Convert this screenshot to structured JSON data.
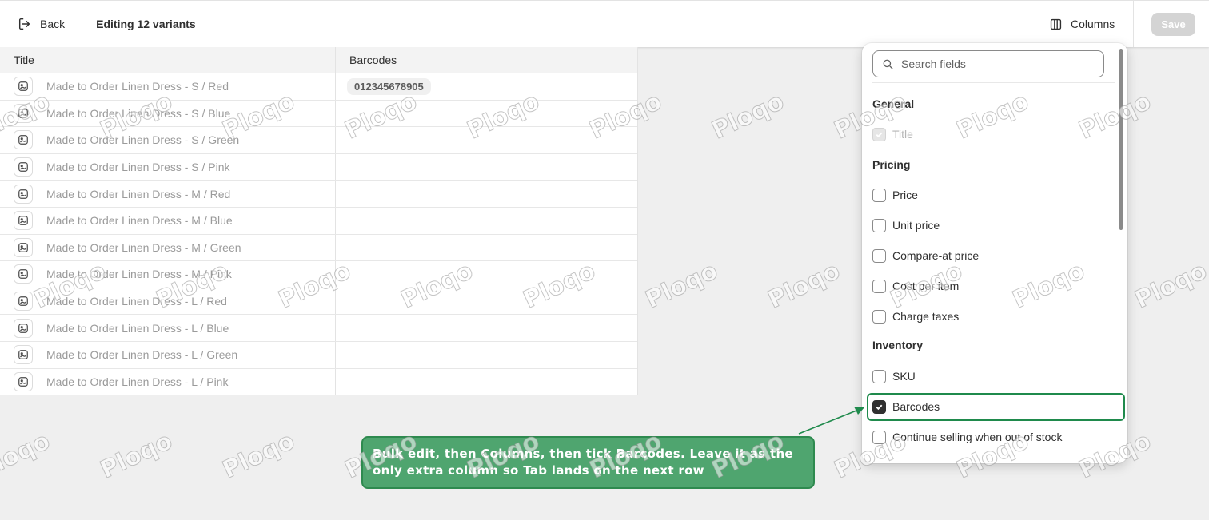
{
  "header": {
    "back_label": "Back",
    "title": "Editing 12 variants",
    "columns_label": "Columns",
    "save_label": "Save"
  },
  "table": {
    "columns": [
      "Title",
      "Barcodes"
    ],
    "rows": [
      {
        "title": "Made to Order Linen Dress - S / Red",
        "barcode": "012345678905"
      },
      {
        "title": "Made to Order Linen Dress - S / Blue",
        "barcode": ""
      },
      {
        "title": "Made to Order Linen Dress - S / Green",
        "barcode": ""
      },
      {
        "title": "Made to Order Linen Dress - S / Pink",
        "barcode": ""
      },
      {
        "title": "Made to Order Linen Dress - M / Red",
        "barcode": ""
      },
      {
        "title": "Made to Order Linen Dress - M / Blue",
        "barcode": ""
      },
      {
        "title": "Made to Order Linen Dress - M / Green",
        "barcode": ""
      },
      {
        "title": "Made to Order Linen Dress - M / Pink",
        "barcode": ""
      },
      {
        "title": "Made to Order Linen Dress - L / Red",
        "barcode": ""
      },
      {
        "title": "Made to Order Linen Dress - L / Blue",
        "barcode": ""
      },
      {
        "title": "Made to Order Linen Dress - L / Green",
        "barcode": ""
      },
      {
        "title": "Made to Order Linen Dress - L / Pink",
        "barcode": ""
      }
    ]
  },
  "picker": {
    "search_placeholder": "Search fields",
    "sections": {
      "general": "General",
      "pricing": "Pricing",
      "inventory": "Inventory"
    },
    "options": {
      "title": {
        "label": "Title",
        "checked": true,
        "disabled": true
      },
      "price": {
        "label": "Price",
        "checked": false
      },
      "unit_price": {
        "label": "Unit price",
        "checked": false
      },
      "compare_at_price": {
        "label": "Compare-at price",
        "checked": false
      },
      "cost_per_item": {
        "label": "Cost per item",
        "checked": false
      },
      "charge_taxes": {
        "label": "Charge taxes",
        "checked": false
      },
      "sku": {
        "label": "SKU",
        "checked": false
      },
      "barcodes": {
        "label": "Barcodes",
        "checked": true
      },
      "continue_selling": {
        "label": "Continue selling when out of stock",
        "checked": false
      }
    }
  },
  "callout": {
    "text": "Bulk edit, then Columns, then tick Barcodes. Leave it as the only extra column so Tab lands on the next row"
  },
  "watermark": "Ploqo",
  "colors": {
    "accent_green": "#1f8a4c",
    "callout_bg": "#4fa56f",
    "checkbox_checked": "#303030"
  }
}
